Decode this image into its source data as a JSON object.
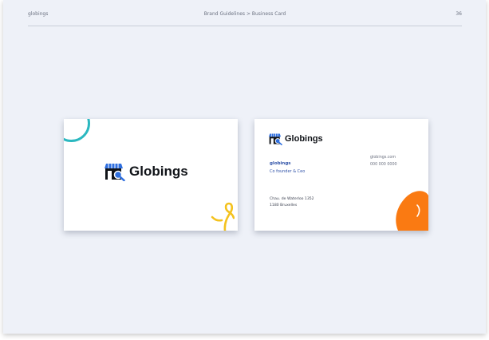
{
  "header": {
    "brand": "globings",
    "breadcrumb": "Brand Guidelines > Business Card",
    "page_number": "36"
  },
  "card_front": {
    "logo_text": "Globings"
  },
  "card_back": {
    "logo_text": "Globings",
    "name": "globings",
    "title": "Co founder & Ceo",
    "website": "globings.com",
    "phone": "000 000 0000",
    "address_line1": "Chau. de Waterloo 1352",
    "address_line2": "1180 Bruxelles"
  },
  "colors": {
    "page_bg": "#eef1f8",
    "logo_blue": "#2f6fdf",
    "logo_dark": "#101318",
    "teal": "#2bb8c0",
    "yellow": "#f4c21e",
    "orange": "#fa7a12",
    "contact_blue": "#2f52a8"
  },
  "icons": {
    "logo": "storefront-search-icon",
    "front_decoration": "teal-ring",
    "front_corner": "yellow-squiggle",
    "back_corner": "orange-blob"
  }
}
